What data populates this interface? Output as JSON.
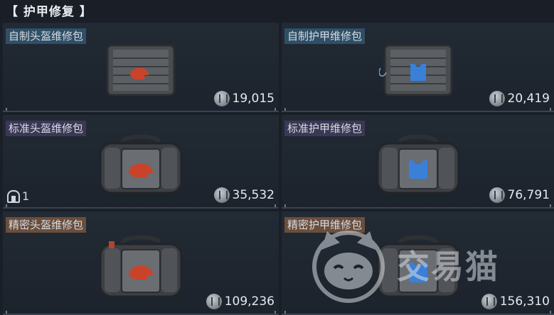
{
  "section": {
    "title": "【 护甲修复 】"
  },
  "cards": [
    {
      "name": "自制头盔维修包",
      "price": "19,015",
      "tier": "custom",
      "kind": "helmet",
      "accent": "#c9432a",
      "bag": "pouch"
    },
    {
      "name": "自制护甲维修包",
      "price": "20,419",
      "tier": "custom",
      "kind": "armor",
      "accent": "#3a7fd8",
      "bag": "pouch"
    },
    {
      "name": "标准头盔维修包",
      "price": "35,532",
      "tier": "standard",
      "kind": "helmet",
      "accent": "#c9432a",
      "bag": "duffel",
      "owned": "1"
    },
    {
      "name": "标准护甲维修包",
      "price": "76,791",
      "tier": "standard",
      "kind": "armor",
      "accent": "#3a7fd8",
      "bag": "duffel"
    },
    {
      "name": "精密头盔维修包",
      "price": "109,236",
      "tier": "precise",
      "kind": "helmet",
      "accent": "#c9432a",
      "bag": "duffel"
    },
    {
      "name": "精密护甲维修包",
      "price": "156,310",
      "tier": "precise",
      "kind": "armor",
      "accent": "#3a7fd8",
      "bag": "duffel"
    }
  ],
  "watermark": {
    "text": "交易猫"
  },
  "colors": {
    "custom": "#2f4f66",
    "standard": "#3b3856",
    "precise": "#6a4e3c"
  }
}
